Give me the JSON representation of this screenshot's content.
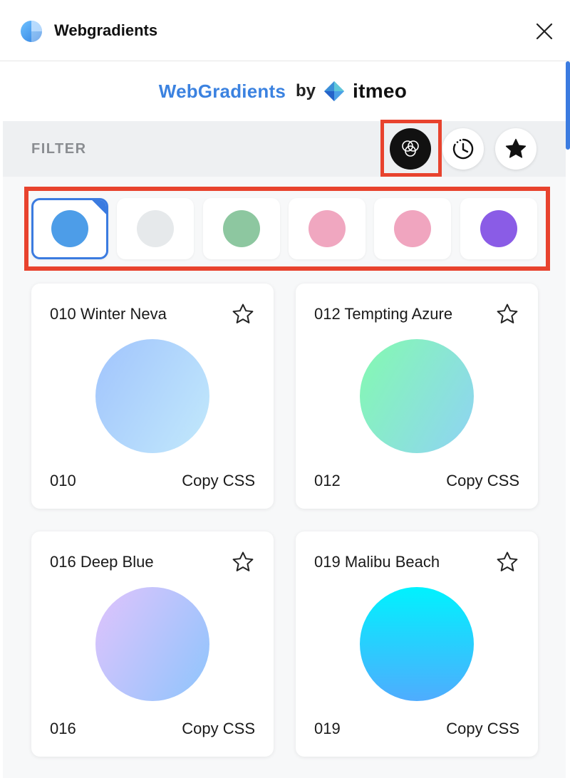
{
  "window": {
    "title": "Webgradients",
    "logo_icon": "webgradients-logo-icon",
    "close_icon": "close-icon"
  },
  "brand": {
    "name": "WebGradients",
    "by": "by",
    "owner": "itmeo",
    "accent_color": "#3b82e0"
  },
  "filter": {
    "label": "FILTER",
    "buttons": [
      {
        "name": "color-filter",
        "icon": "overlapping-circles-icon",
        "active": true
      },
      {
        "name": "recent-filter",
        "icon": "clock-history-icon",
        "active": false
      },
      {
        "name": "favorites-filter",
        "icon": "star-filled-icon",
        "active": false
      }
    ]
  },
  "colors": [
    {
      "name": "blue",
      "hex": "#4d9de8",
      "selected": true
    },
    {
      "name": "gray",
      "hex": "#e6e9eb",
      "selected": false
    },
    {
      "name": "green",
      "hex": "#8dc7a0",
      "selected": false
    },
    {
      "name": "pink",
      "hex": "#f0a7c0",
      "selected": false
    },
    {
      "name": "rose",
      "hex": "#f0a5bf",
      "selected": false
    },
    {
      "name": "purple",
      "hex": "#8a5ce6",
      "selected": false
    }
  ],
  "gradients": [
    {
      "title": "010 Winter Neva",
      "number": "010",
      "copy_label": "Copy CSS",
      "from": "#a1c4fd",
      "to": "#c2e9fb",
      "direction": "120deg"
    },
    {
      "title": "012 Tempting Azure",
      "number": "012",
      "copy_label": "Copy CSS",
      "from": "#84fab0",
      "to": "#8fd3f4",
      "direction": "120deg"
    },
    {
      "title": "016 Deep Blue",
      "number": "016",
      "copy_label": "Copy CSS",
      "from": "#e0c3fc",
      "to": "#8ec5fc",
      "direction": "120deg"
    },
    {
      "title": "019 Malibu Beach",
      "number": "019",
      "copy_label": "Copy CSS",
      "from": "#4facfe",
      "to": "#00f2fe",
      "direction": "to top"
    }
  ]
}
